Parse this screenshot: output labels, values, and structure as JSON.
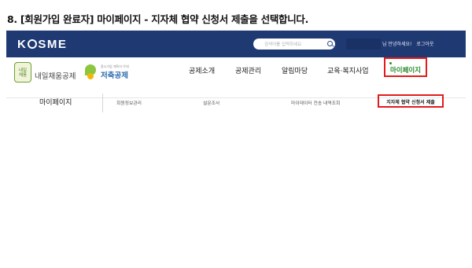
{
  "step_title": "8. [회원가입 완료자] 마이페이지 - 지자체 협약 신청서 제출을 선택합니다.",
  "header": {
    "logo_left": "K",
    "logo_right": "SME",
    "search_placeholder": "검색어를 입력하세요",
    "greeting": "님 안녕하세요!",
    "logout": "로그아웃"
  },
  "brands": {
    "brand1_icon_text": "내일\n채움",
    "brand1_label": "내일채움공제",
    "brand2_sub": "중소기업 재직자 우대",
    "brand2_label": "저축공제"
  },
  "menu": {
    "items": [
      "공제소개",
      "공제관리",
      "알림마당",
      "교육·복지사업"
    ],
    "mypage": "마이페이지"
  },
  "subnav": {
    "title": "마이페이지",
    "items": [
      "회원정보관리",
      "설문조사",
      "마이데이터 전송 내역조회"
    ],
    "highlight": "지자체 협약 신청서 제출"
  },
  "colors": {
    "header_bg": "#1f3a73",
    "highlight_border": "#e21b1b",
    "mypage_text": "#2e8b2e"
  }
}
